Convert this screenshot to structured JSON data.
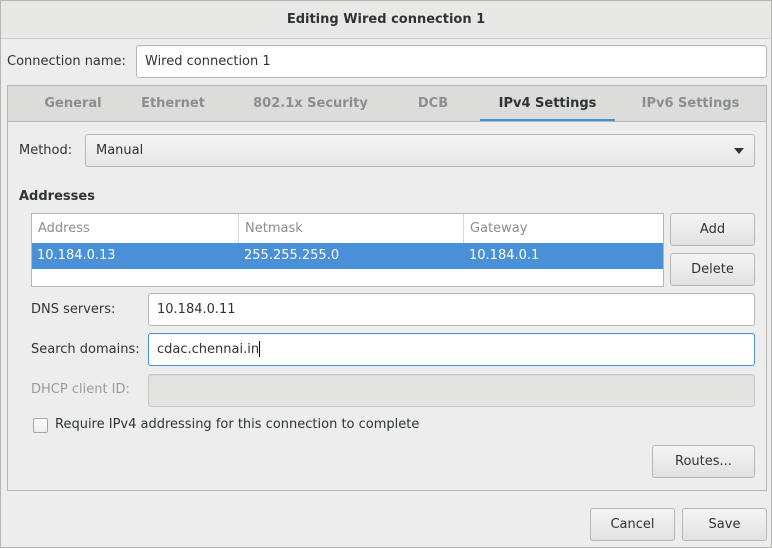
{
  "window": {
    "title": "Editing Wired connection 1"
  },
  "connection": {
    "label": "Connection name:",
    "value": "Wired connection 1"
  },
  "tabs": [
    {
      "label": "General"
    },
    {
      "label": "Ethernet"
    },
    {
      "label": "802.1x Security"
    },
    {
      "label": "DCB"
    },
    {
      "label": "IPv4 Settings"
    },
    {
      "label": "IPv6 Settings"
    }
  ],
  "active_tab": "IPv4 Settings",
  "method": {
    "label": "Method:",
    "value": "Manual"
  },
  "addresses": {
    "heading": "Addresses",
    "columns": [
      "Address",
      "Netmask",
      "Gateway"
    ],
    "rows": [
      {
        "address": "10.184.0.13",
        "netmask": "255.255.255.0",
        "gateway": "10.184.0.1"
      }
    ],
    "add_label": "Add",
    "delete_label": "Delete"
  },
  "dns": {
    "label": "DNS servers:",
    "value": "10.184.0.11"
  },
  "search_domains": {
    "label": "Search domains:",
    "value": "cdac.chennai.in"
  },
  "dhcp_client_id": {
    "label": "DHCP client ID:",
    "value": ""
  },
  "require_ipv4": {
    "label": "Require IPv4 addressing for this connection to complete",
    "checked": false
  },
  "routes_label": "Routes...",
  "footer": {
    "cancel_label": "Cancel",
    "save_label": "Save"
  },
  "colors": {
    "accent": "#4a90d9",
    "background": "#ededed"
  }
}
